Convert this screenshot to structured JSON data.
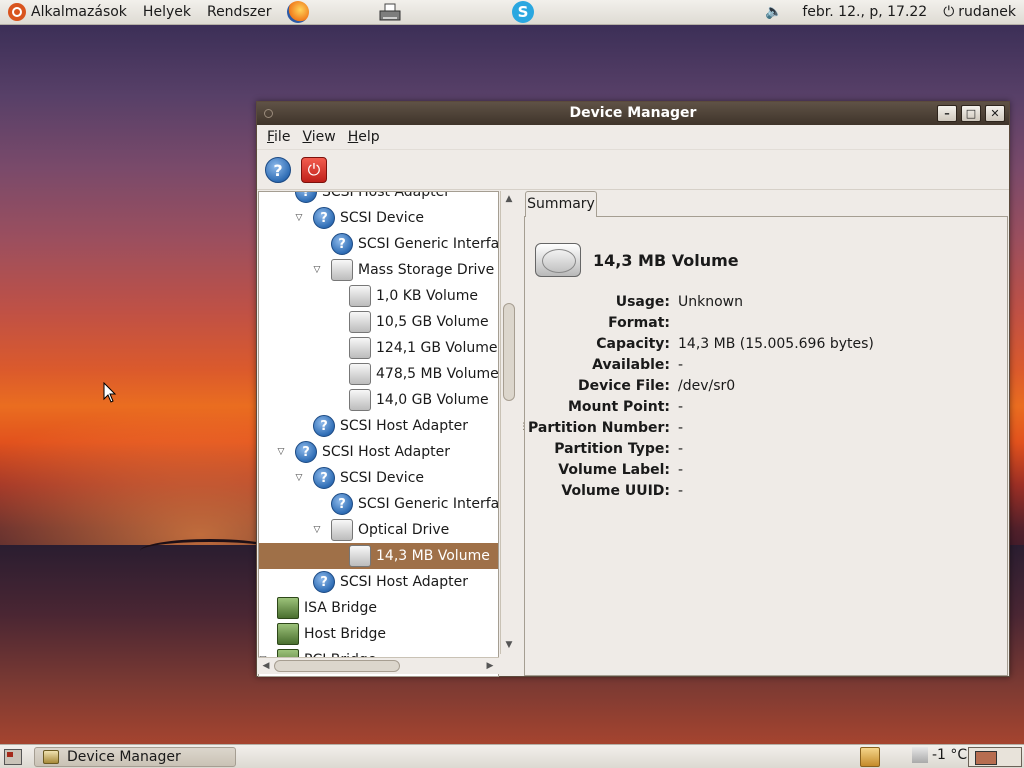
{
  "top_panel": {
    "menus": [
      "Alkalmazások",
      "Helyek",
      "Rendszer"
    ],
    "clock": "febr. 12., p, 17.22",
    "user": "rudanek"
  },
  "window": {
    "title": "Device Manager",
    "menu": [
      "File",
      "View",
      "Help"
    ],
    "toolbar": [
      "help-icon",
      "quit-icon"
    ]
  },
  "tree": {
    "rows": [
      {
        "label": "SCSI Host Adapter",
        "icon": "question",
        "level": 3,
        "expander": ""
      },
      {
        "label": "SCSI Device",
        "icon": "question",
        "level": 4,
        "expander": "open"
      },
      {
        "label": "SCSI Generic Interface",
        "icon": "question",
        "level": 5,
        "expander": ""
      },
      {
        "label": "Mass Storage Drive",
        "icon": "disk",
        "level": 5,
        "expander": "open"
      },
      {
        "label": "1,0 KB Volume",
        "icon": "disk",
        "level": 6,
        "expander": ""
      },
      {
        "label": "10,5 GB Volume",
        "icon": "disk",
        "level": 6,
        "expander": ""
      },
      {
        "label": "124,1 GB Volume",
        "icon": "disk",
        "level": 6,
        "expander": ""
      },
      {
        "label": "478,5 MB Volume",
        "icon": "disk",
        "level": 6,
        "expander": ""
      },
      {
        "label": "14,0 GB Volume",
        "icon": "disk",
        "level": 6,
        "expander": ""
      },
      {
        "label": "SCSI Host Adapter",
        "icon": "question",
        "level": 4,
        "expander": ""
      },
      {
        "label": "SCSI Host Adapter",
        "icon": "question",
        "level": 3,
        "expander": "open"
      },
      {
        "label": "SCSI Device",
        "icon": "question",
        "level": 4,
        "expander": "open"
      },
      {
        "label": "SCSI Generic Interface",
        "icon": "question",
        "level": 5,
        "expander": ""
      },
      {
        "label": "Optical Drive",
        "icon": "disk",
        "level": 5,
        "expander": "open"
      },
      {
        "label": "14,3 MB Volume",
        "icon": "disk",
        "level": 6,
        "expander": "",
        "selected": true
      },
      {
        "label": "SCSI Host Adapter",
        "icon": "question",
        "level": 4,
        "expander": ""
      },
      {
        "label": "ISA Bridge",
        "icon": "chip",
        "level": 2,
        "expander": ""
      },
      {
        "label": "Host Bridge",
        "icon": "chip",
        "level": 2,
        "expander": ""
      },
      {
        "label": "PCI Bridge",
        "icon": "chip",
        "level": 2,
        "expander": "open"
      }
    ]
  },
  "summary": {
    "tab": "Summary",
    "title": "14,3 MB Volume",
    "properties": [
      {
        "key": "Usage:",
        "value": "Unknown"
      },
      {
        "key": "Format:",
        "value": ""
      },
      {
        "key": "Capacity:",
        "value": "14,3 MB (15.005.696 bytes)"
      },
      {
        "key": "Available:",
        "value": "-"
      },
      {
        "key": "Device File:",
        "value": "/dev/sr0"
      },
      {
        "key": "Mount Point:",
        "value": "-"
      },
      {
        "key": "Partition Number:",
        "value": "-"
      },
      {
        "key": "Partition Type:",
        "value": "-"
      },
      {
        "key": "Volume Label:",
        "value": "-"
      },
      {
        "key": "Volume UUID:",
        "value": "-"
      }
    ]
  },
  "bottom_panel": {
    "task": "Device Manager",
    "temperature": "-1 °C"
  },
  "colors": {
    "selection": "#9f7048",
    "titlebar": "#4e4237",
    "panel": "#e6e3dc"
  }
}
